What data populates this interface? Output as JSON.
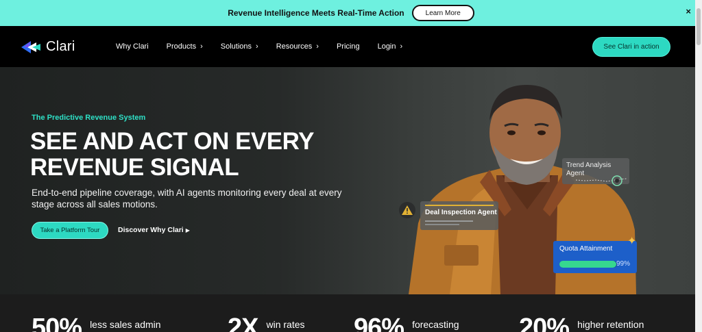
{
  "announcement": {
    "text": "Revenue Intelligence Meets Real-Time Action",
    "button_label": "Learn More",
    "close_label": "×"
  },
  "nav": {
    "logo_text": "Clari",
    "items": [
      {
        "label": "Why Clari",
        "has_chevron": false
      },
      {
        "label": "Products",
        "has_chevron": true
      },
      {
        "label": "Solutions",
        "has_chevron": true
      },
      {
        "label": "Resources",
        "has_chevron": true
      },
      {
        "label": "Pricing",
        "has_chevron": false
      },
      {
        "label": "Login",
        "has_chevron": true
      }
    ],
    "chevron": "›",
    "cta_label": "See Clari in action"
  },
  "hero": {
    "eyebrow": "The Predictive Revenue System",
    "headline_line1": "SEE AND ACT ON EVERY",
    "headline_line2": "REVENUE SIGNAL",
    "subtext": "End-to-end pipeline coverage, with AI agents monitoring every deal at every stage across all sales motions.",
    "primary_button": "Take a Platform Tour",
    "secondary_link": "Discover Why Clari",
    "secondary_arrow": "▶"
  },
  "cards": {
    "trend": {
      "line1": "Trend Analysis",
      "line2": "Agent"
    },
    "deal": {
      "label": "Deal Inspection Agent",
      "warning_icon": "warning-icon"
    },
    "quota": {
      "label": "Quota Attainment",
      "percent_label": "99%",
      "percent_value": 0.99
    }
  },
  "stats": [
    {
      "value": "50%",
      "label": "less sales admin"
    },
    {
      "value": "2X",
      "label": "win rates"
    },
    {
      "value": "96%",
      "label": "forecasting"
    },
    {
      "value": "20%",
      "label": "higher retention"
    }
  ],
  "colors": {
    "accent": "#2dd9c2",
    "banner": "#6ef0df",
    "quota_card": "#1d5fc9",
    "progress_fill": "#36d88f",
    "warning": "#e2b234"
  }
}
